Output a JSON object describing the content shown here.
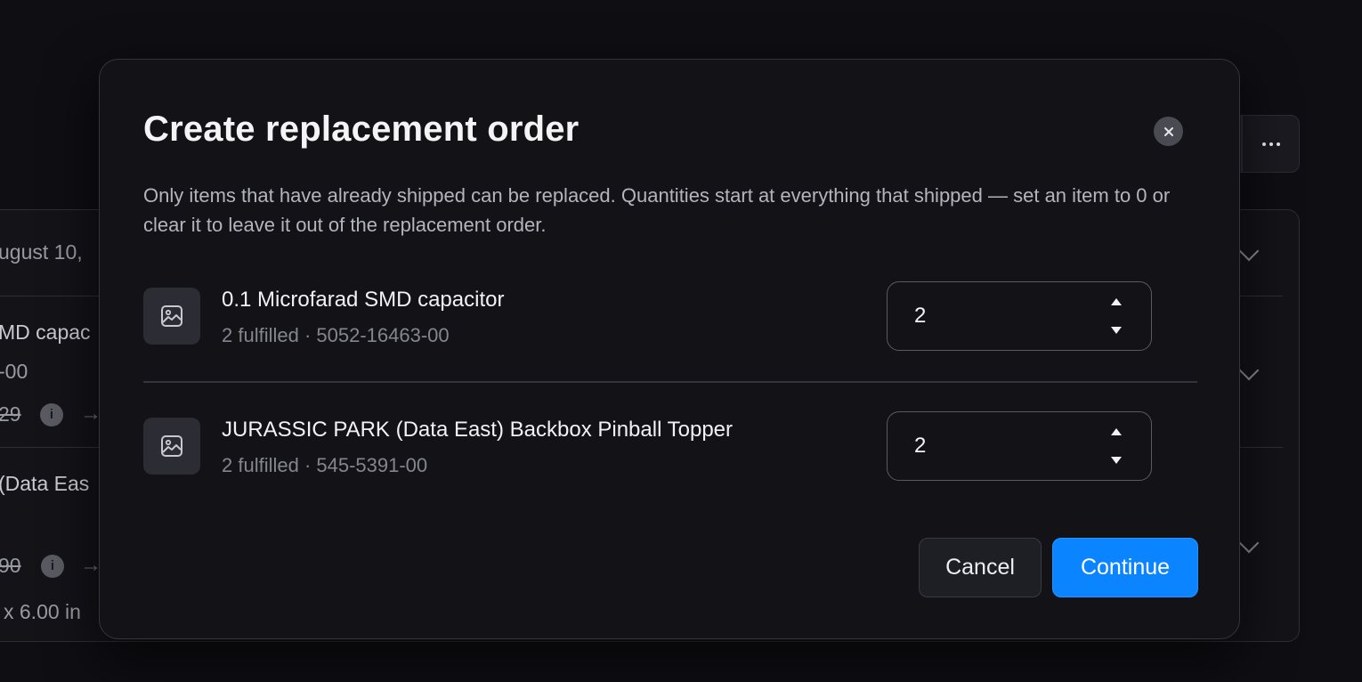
{
  "background": {
    "date_fragment": "ugust 10,",
    "item1_name_fragment": "MD capac",
    "item1_sku_fragment": "-00",
    "item1_price_fragment": "29",
    "item2_name_fragment": "(Data Eas",
    "item2_sku_fragment": ")",
    "item2_price_fragment": "90",
    "dimensions_fragment": "x 6.00 in",
    "info_glyph": "i",
    "arrow_glyph": "→"
  },
  "modal": {
    "title": "Create replacement order",
    "description": "Only items that have already shipped can be replaced. Quantities start at everything that shipped — set an item to 0 or clear it to leave it out of the replacement order.",
    "items": [
      {
        "name": "0.1 Microfarad SMD capacitor",
        "meta": "2 fulfilled · 5052-16463-00",
        "quantity": "2"
      },
      {
        "name": "JURASSIC PARK (Data East) Backbox Pinball Topper",
        "meta": "2 fulfilled · 545-5391-00",
        "quantity": "2"
      }
    ],
    "cancel_label": "Cancel",
    "continue_label": "Continue"
  }
}
